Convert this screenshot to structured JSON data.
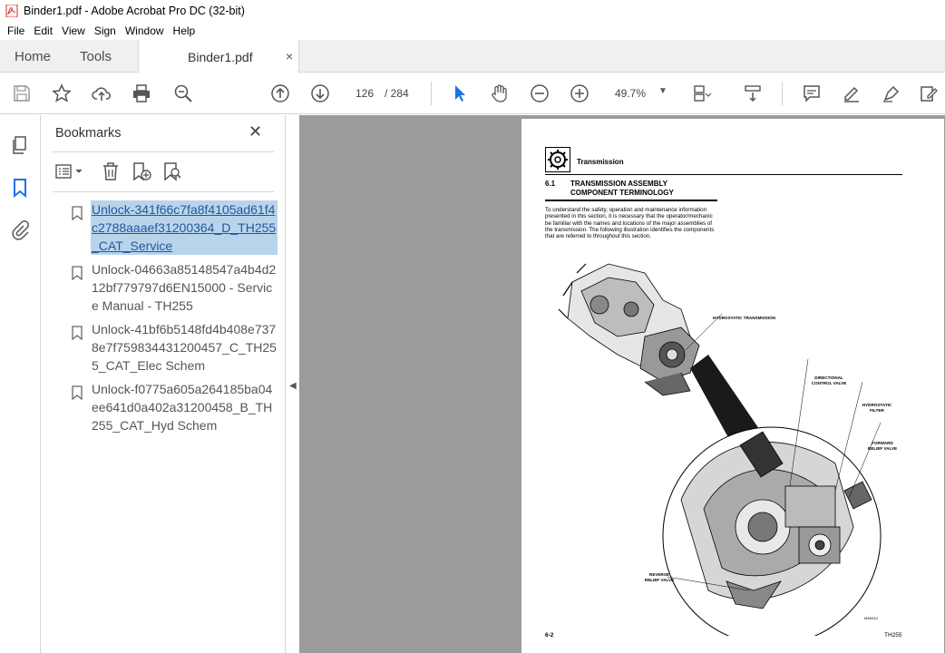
{
  "window": {
    "title": "Binder1.pdf - Adobe Acrobat Pro DC (32-bit)"
  },
  "menu": [
    "File",
    "Edit",
    "View",
    "Sign",
    "Window",
    "Help"
  ],
  "tabs": {
    "home": "Home",
    "tools": "Tools",
    "document": "Binder1.pdf",
    "close": "×"
  },
  "toolbar": {
    "page_current": "126",
    "page_total": "/ 284",
    "zoom": "49.7%"
  },
  "bookmarks": {
    "title": "Bookmarks",
    "close": "✕",
    "items": [
      {
        "label": "Unlock-341f66c7fa8f4105ad61f4c2788aaaef31200364_D_TH255_CAT_Service",
        "selected": true
      },
      {
        "label": "Unlock-04663a85148547a4b4d212bf779797d6EN15000 - Service Manual - TH255",
        "selected": false
      },
      {
        "label": "Unlock-41bf6b5148fd4b408e7378e7f759834431200457_C_TH255_CAT_Elec Schem",
        "selected": false
      },
      {
        "label": "Unlock-f0775a605a264185ba04ee641d0a402a31200458_B_TH255_CAT_Hyd Schem",
        "selected": false
      }
    ]
  },
  "document_page": {
    "header": "Transmission",
    "section_number": "6.1",
    "section_title_1": "TRANSMISSION ASSEMBLY",
    "section_title_2": "COMPONENT TERMINOLOGY",
    "body": "To understand the safety, operation and maintenance information presented in this section, it is necessary that the operator/mechanic be familiar with the names and locations of the major assemblies of the transmission. The following illustration identifies the components that are referred to throughout this section.",
    "labels": {
      "hydrostatic_transmission": "HYDROSTATIC TRANSMISSION",
      "directional_control_valve": "DIRECTIONAL CONTROL VALVE",
      "hydrostatic_filter": "HYDROSTATIC FILTER",
      "forward_relief_valve": "FORWARD RELIEF VALVE",
      "reverse_relief_valve": "REVERSE RELIEF VALVE"
    },
    "figure_id": "MA0610",
    "footer_left": "6-2",
    "footer_right": "TH255"
  },
  "colors": {
    "accent_blue": "#1a73e8",
    "selection_bg": "#b9d4ea",
    "doc_bg": "#9b9b9b",
    "pdf_red": "#d62b20"
  }
}
